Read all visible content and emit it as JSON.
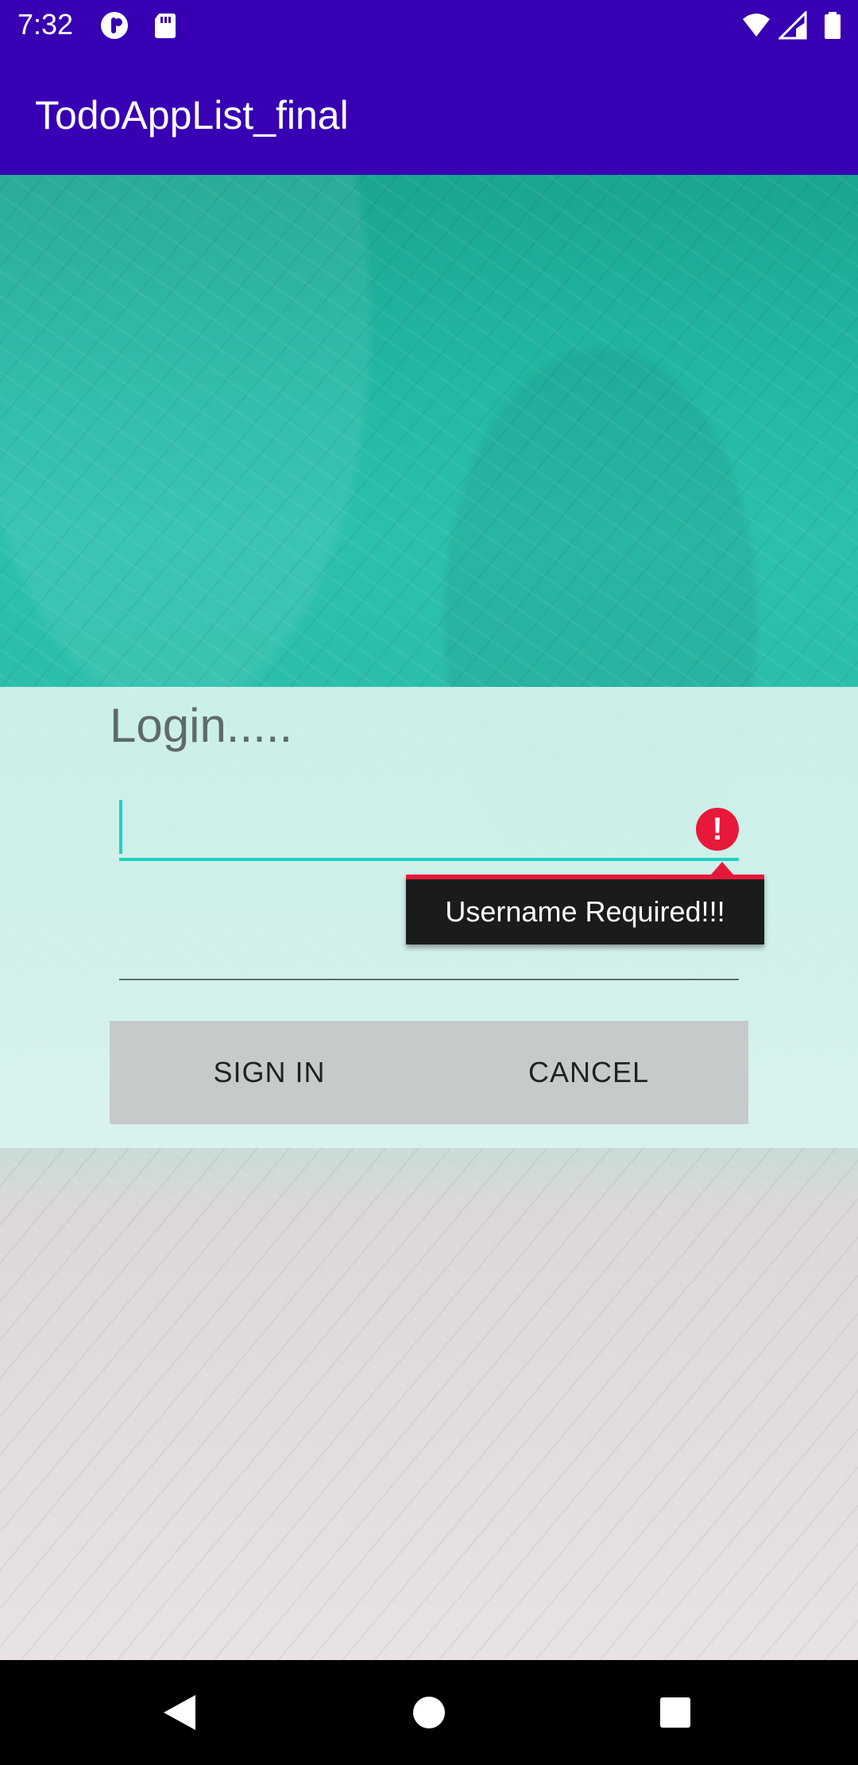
{
  "status_bar": {
    "time": "7:32",
    "left_icons": [
      "podcast-icon",
      "sd-card-icon"
    ],
    "right_icons": [
      "wifi-icon",
      "cellular-signal-icon",
      "battery-icon"
    ]
  },
  "app_bar": {
    "title": "TodoAppList_final"
  },
  "login": {
    "title": "Login.....",
    "username": {
      "value": "",
      "placeholder": ""
    },
    "password": {
      "value": "",
      "placeholder": ""
    },
    "error_message": "Username Required!!!",
    "sign_in_label": "SIGN IN",
    "cancel_label": "CANCEL"
  },
  "nav_bar": {
    "buttons": [
      "back-icon",
      "home-icon",
      "recents-icon"
    ]
  },
  "colors": {
    "app_bar": "#3700b3",
    "accent": "#1ed2bf",
    "error": "#e8183a",
    "button_bar": "#c5cbcb"
  }
}
